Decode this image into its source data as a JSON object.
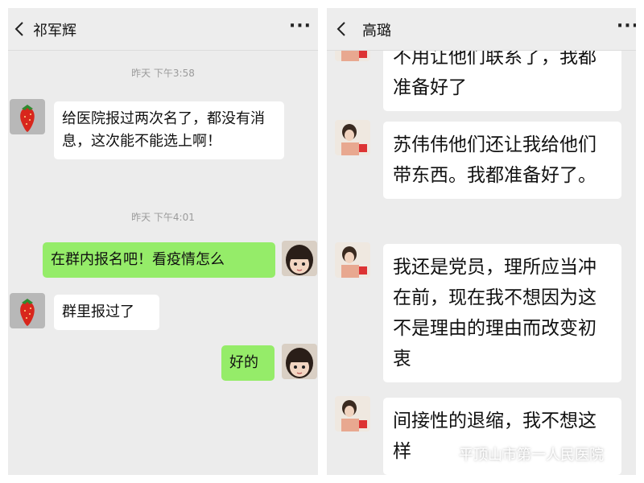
{
  "left_chat": {
    "title": "祁军辉",
    "messages": [
      {
        "type": "time",
        "text": "昨天 下午3:58"
      },
      {
        "type": "msg",
        "side": "left",
        "text": "给医院报过两次名了，都没有消息，这次能不能选上啊！"
      },
      {
        "type": "time",
        "text": "昨天 下午4:01"
      },
      {
        "type": "msg",
        "side": "right",
        "text": "在群内报名吧！看疫情怎么"
      },
      {
        "type": "msg",
        "side": "left",
        "text": "群里报过了"
      },
      {
        "type": "msg",
        "side": "right",
        "text": "好的"
      }
    ]
  },
  "right_chat": {
    "title": "高璐",
    "messages": [
      {
        "side": "left",
        "text": "不用让他们联系了，我都准备好了"
      },
      {
        "side": "left",
        "text": "苏伟伟他们还让我给他们带东西。我都准备好了。"
      },
      {
        "side": "left",
        "text": "我还是党员，理所应当冲在前，现在我不想因为这不是理由的理由而改变初衷"
      },
      {
        "side": "left",
        "text": "间接性的退缩，我不想这样"
      }
    ]
  },
  "watermark": {
    "text": "平顶山市第一人民医院"
  },
  "colors": {
    "background": "#ececec",
    "header": "#ededed",
    "bubble_white": "#ffffff",
    "bubble_green": "#95ec69"
  },
  "icons": {
    "back": "chevron-left-icon",
    "more": "more-dots-icon",
    "watermark": "wechat-logo-icon"
  }
}
